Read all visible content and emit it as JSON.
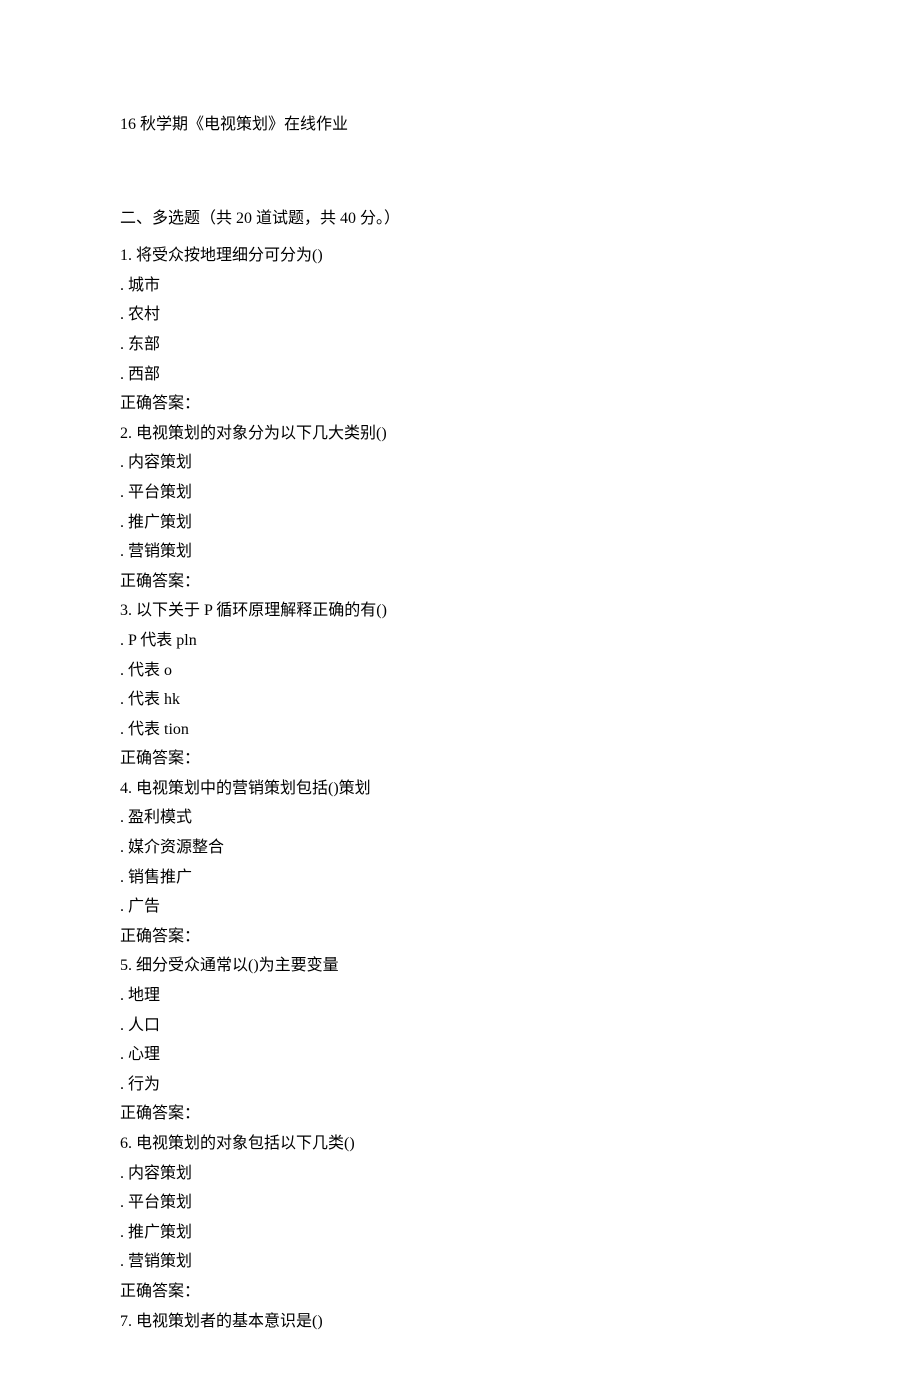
{
  "title": "16 秋学期《电视策划》在线作业",
  "section_header": "二、多选题（共 20 道试题，共 40 分。）",
  "questions": [
    {
      "num": "1.",
      "text": "将受众按地理细分可分为()",
      "options": [
        "城市",
        "农村",
        "东部",
        "西部"
      ],
      "answer_label": "正确答案："
    },
    {
      "num": "2.",
      "text": "电视策划的对象分为以下几大类别()",
      "options": [
        "内容策划",
        "平台策划",
        "推广策划",
        "营销策划"
      ],
      "answer_label": "正确答案："
    },
    {
      "num": "3.",
      "text": "以下关于 P 循环原理解释正确的有()",
      "options": [
        "P 代表 pln",
        "代表 o",
        "代表 hk",
        "代表 tion"
      ],
      "answer_label": "正确答案："
    },
    {
      "num": "4.",
      "text": "电视策划中的营销策划包括()策划",
      "options": [
        "盈利模式",
        "媒介资源整合",
        "销售推广",
        "广告"
      ],
      "answer_label": "正确答案："
    },
    {
      "num": "5.",
      "text": "细分受众通常以()为主要变量",
      "options": [
        "地理",
        "人口",
        "心理",
        "行为"
      ],
      "answer_label": "正确答案："
    },
    {
      "num": "6.",
      "text": "电视策划的对象包括以下几类()",
      "options": [
        "内容策划",
        "平台策划",
        "推广策划",
        "营销策划"
      ],
      "answer_label": "正确答案："
    },
    {
      "num": "7.",
      "text": "电视策划者的基本意识是()",
      "options": [],
      "answer_label": ""
    }
  ]
}
